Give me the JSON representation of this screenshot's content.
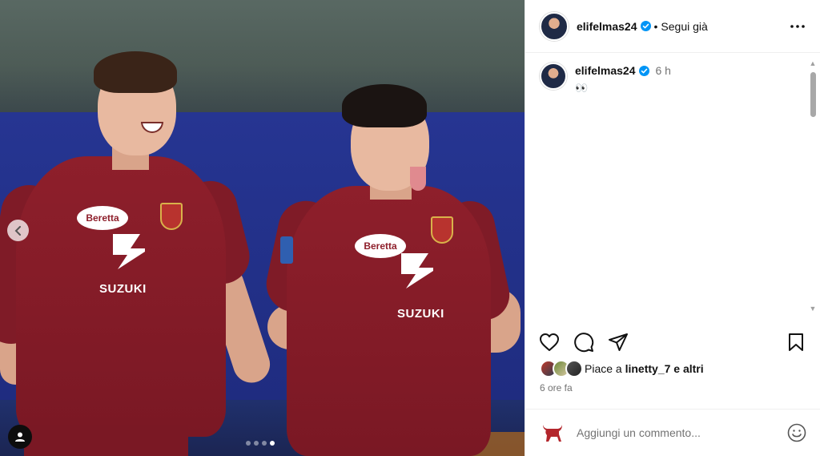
{
  "post": {
    "author": "elifelmas24",
    "follow_label": "Segui già",
    "separator": "•",
    "caption_author": "elifelmas24",
    "caption_time": "6 h",
    "caption_text": "👀",
    "likes_prefix": "Piace a",
    "likes_user": "linetty_7",
    "likes_suffix": "e altri",
    "time_ago": "6 ore fa",
    "comment_placeholder": "Aggiungi un commento..."
  },
  "photo": {
    "sponsor": "Beretta",
    "sponsor_word": "SUZUKI",
    "carousel_count": 4,
    "carousel_active": 3
  },
  "colors": {
    "verified": "#0095f6",
    "jersey": "#8e1f2b",
    "board": "#263592"
  },
  "icons": [
    "verified-icon",
    "more-options-icon",
    "heart-icon",
    "comment-icon",
    "share-icon",
    "bookmark-icon",
    "emoji-icon",
    "bull-avatar-icon",
    "user-tag-icon",
    "chevron-left-icon"
  ]
}
